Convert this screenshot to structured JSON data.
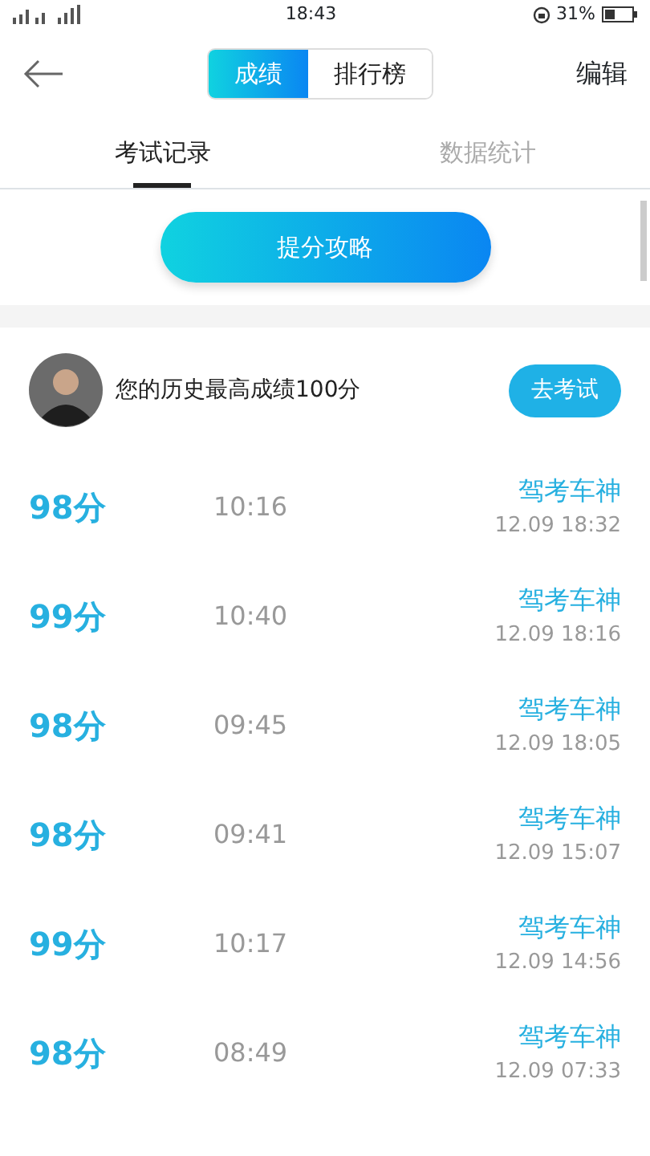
{
  "status_bar": {
    "time": "18:43",
    "battery": "31%"
  },
  "header": {
    "segments": [
      {
        "label": "成绩",
        "selected": true
      },
      {
        "label": "排行榜",
        "selected": false
      }
    ],
    "action": "编辑"
  },
  "tabs": [
    {
      "label": "考试记录",
      "selected": true
    },
    {
      "label": "数据统计",
      "selected": false
    }
  ],
  "tips_button": "提分攻略",
  "best": {
    "text": "您的历史最高成绩100分",
    "button": "去考试"
  },
  "records": [
    {
      "score": "98分",
      "duration": "10:16",
      "source": "驾考车神",
      "date": "12.09  18:32"
    },
    {
      "score": "99分",
      "duration": "10:40",
      "source": "驾考车神",
      "date": "12.09  18:16"
    },
    {
      "score": "98分",
      "duration": "09:45",
      "source": "驾考车神",
      "date": "12.09  18:05"
    },
    {
      "score": "98分",
      "duration": "09:41",
      "source": "驾考车神",
      "date": "12.09  15:07"
    },
    {
      "score": "99分",
      "duration": "10:17",
      "source": "驾考车神",
      "date": "12.09  14:56"
    },
    {
      "score": "98分",
      "duration": "08:49",
      "source": "驾考车神",
      "date": "12.09  07:33"
    }
  ]
}
